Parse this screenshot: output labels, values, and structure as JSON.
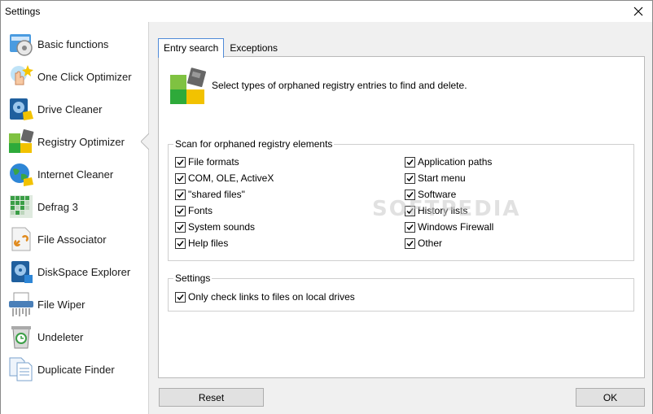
{
  "window": {
    "title": "Settings"
  },
  "sidebar": {
    "items": [
      {
        "label": "Basic functions",
        "icon": "basic-functions-icon"
      },
      {
        "label": "One Click Optimizer",
        "icon": "one-click-optimizer-icon"
      },
      {
        "label": "Drive Cleaner",
        "icon": "drive-cleaner-icon"
      },
      {
        "label": "Registry Optimizer",
        "icon": "registry-optimizer-icon",
        "active": true
      },
      {
        "label": "Internet Cleaner",
        "icon": "internet-cleaner-icon"
      },
      {
        "label": "Defrag 3",
        "icon": "defrag-icon"
      },
      {
        "label": "File Associator",
        "icon": "file-associator-icon"
      },
      {
        "label": "DiskSpace Explorer",
        "icon": "diskspace-explorer-icon"
      },
      {
        "label": "File Wiper",
        "icon": "file-wiper-icon"
      },
      {
        "label": "Undeleter",
        "icon": "undeleter-icon"
      },
      {
        "label": "Duplicate Finder",
        "icon": "duplicate-finder-icon"
      }
    ]
  },
  "tabs": [
    {
      "label": "Entry search",
      "active": true
    },
    {
      "label": "Exceptions",
      "active": false
    }
  ],
  "panel": {
    "intro": "Select types of orphaned registry entries to find and delete.",
    "scan_group": {
      "title": "Scan for orphaned registry elements",
      "left": [
        {
          "label": "File formats",
          "checked": true
        },
        {
          "label": "COM, OLE, ActiveX",
          "checked": true
        },
        {
          "label": "\"shared files\"",
          "checked": true
        },
        {
          "label": "Fonts",
          "checked": true
        },
        {
          "label": "System sounds",
          "checked": true
        },
        {
          "label": "Help files",
          "checked": true
        }
      ],
      "right": [
        {
          "label": "Application paths",
          "checked": true
        },
        {
          "label": "Start menu",
          "checked": true
        },
        {
          "label": "Software",
          "checked": true
        },
        {
          "label": "History lists",
          "checked": true
        },
        {
          "label": "Windows Firewall",
          "checked": true
        },
        {
          "label": "Other",
          "checked": true
        }
      ]
    },
    "settings_group": {
      "title": "Settings",
      "option": {
        "label": "Only check links to files on local drives",
        "checked": true
      }
    }
  },
  "buttons": {
    "reset": "Reset",
    "ok": "OK"
  },
  "watermark": "SOFTPEDIA",
  "colors": {
    "accent": "#4f8ad8",
    "panel_bg": "#f0f0f0",
    "green": "#2eaa3a",
    "yellow": "#f2c200"
  }
}
